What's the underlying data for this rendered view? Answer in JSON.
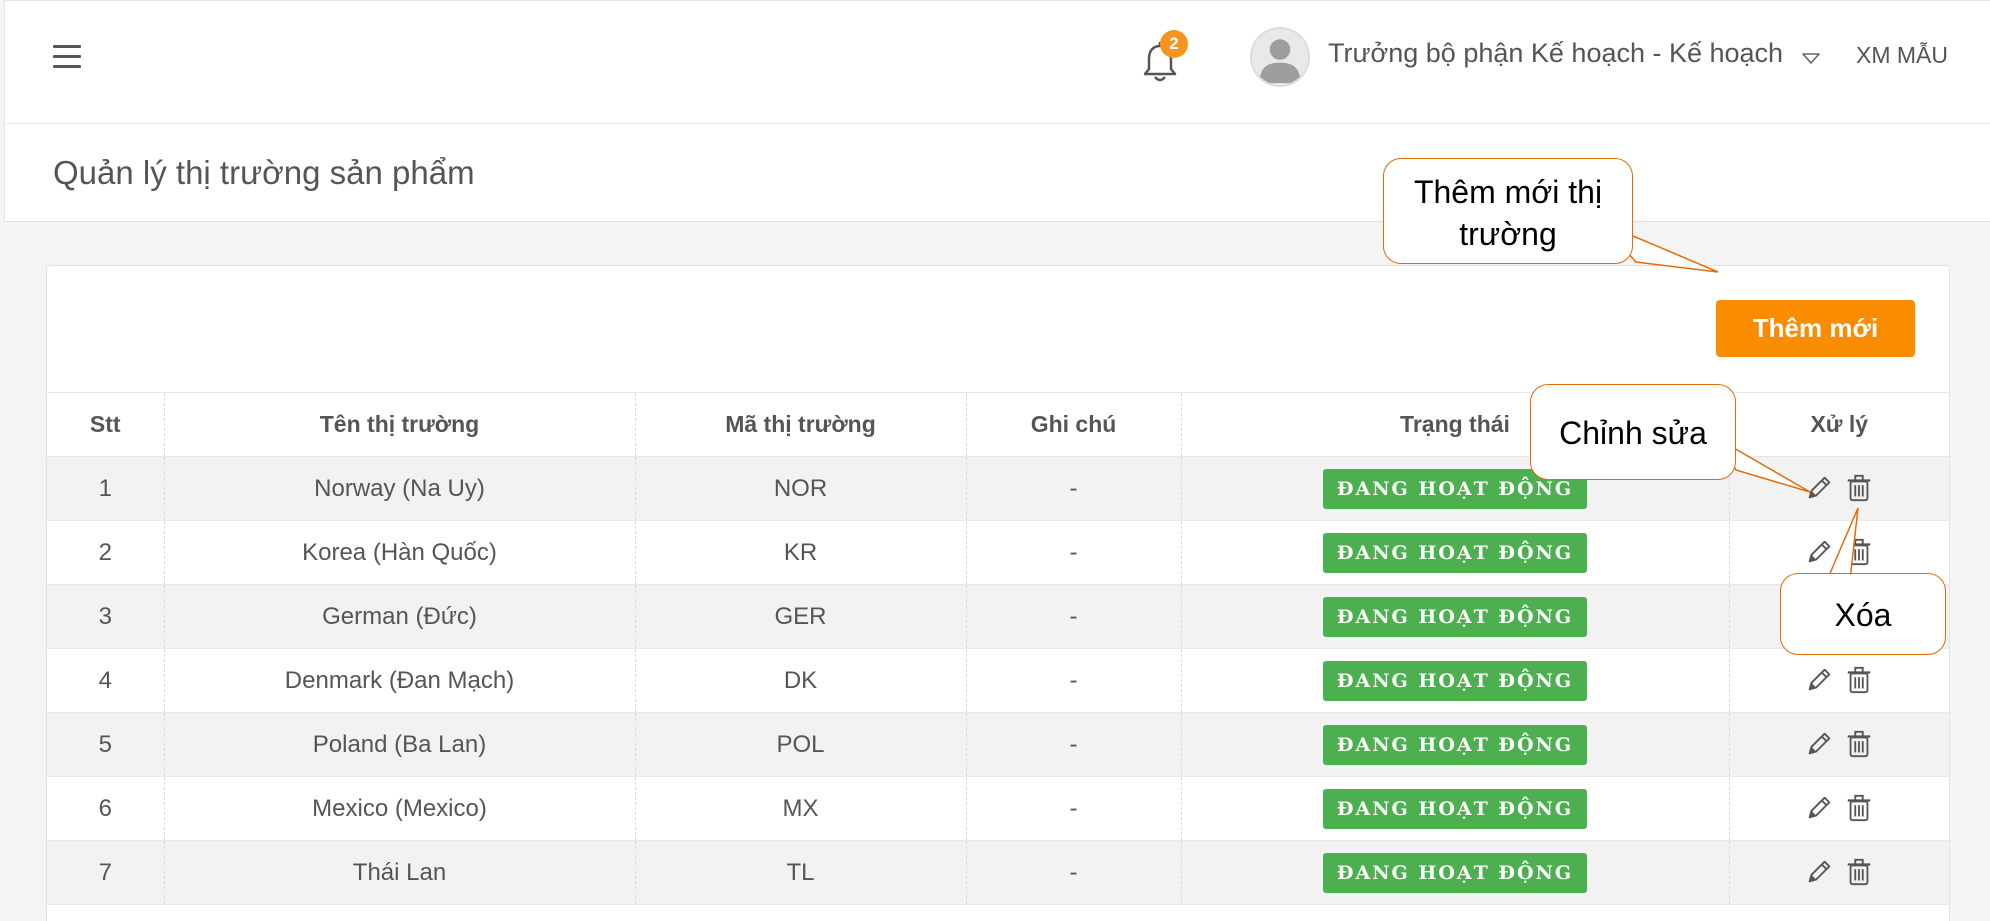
{
  "header": {
    "notification_count": "2",
    "user_name": "Trưởng bộ phận Kế hoạch - Kế hoạch",
    "org_name": "XM MẪU"
  },
  "page": {
    "title": "Quản lý thị trường sản phẩm",
    "add_button_label": "Thêm mới"
  },
  "table": {
    "columns": [
      "Stt",
      "Tên thị trường",
      "Mã thị trường",
      "Ghi chú",
      "Trạng thái",
      "Xử lý"
    ],
    "rows": [
      {
        "stt": "1",
        "name": "Norway (Na Uy)",
        "code": "NOR",
        "note": "-",
        "status": "ĐANG HOẠT ĐỘNG"
      },
      {
        "stt": "2",
        "name": "Korea (Hàn Quốc)",
        "code": "KR",
        "note": "-",
        "status": "ĐANG HOẠT ĐỘNG"
      },
      {
        "stt": "3",
        "name": "German (Đức)",
        "code": "GER",
        "note": "-",
        "status": "ĐANG HOẠT ĐỘNG"
      },
      {
        "stt": "4",
        "name": "Denmark (Đan Mạch)",
        "code": "DK",
        "note": "-",
        "status": "ĐANG HOẠT ĐỘNG"
      },
      {
        "stt": "5",
        "name": "Poland (Ba Lan)",
        "code": "POL",
        "note": "-",
        "status": "ĐANG HOẠT ĐỘNG"
      },
      {
        "stt": "6",
        "name": "Mexico (Mexico)",
        "code": "MX",
        "note": "-",
        "status": "ĐANG HOẠT ĐỘNG"
      },
      {
        "stt": "7",
        "name": "Thái Lan",
        "code": "TL",
        "note": "-",
        "status": "ĐANG HOẠT ĐỘNG"
      }
    ]
  },
  "annotations": {
    "add_market_line1": "Thêm mới thị",
    "add_market_line2": "trường",
    "edit": "Chỉnh sửa",
    "delete": "Xóa"
  },
  "colors": {
    "accent_orange": "#fb8c00",
    "status_green": "#4caf50",
    "callout_border": "#e36c09"
  },
  "icons": [
    "menu-icon",
    "bell-icon",
    "avatar",
    "caret-down-icon",
    "edit-icon",
    "trash-icon"
  ]
}
